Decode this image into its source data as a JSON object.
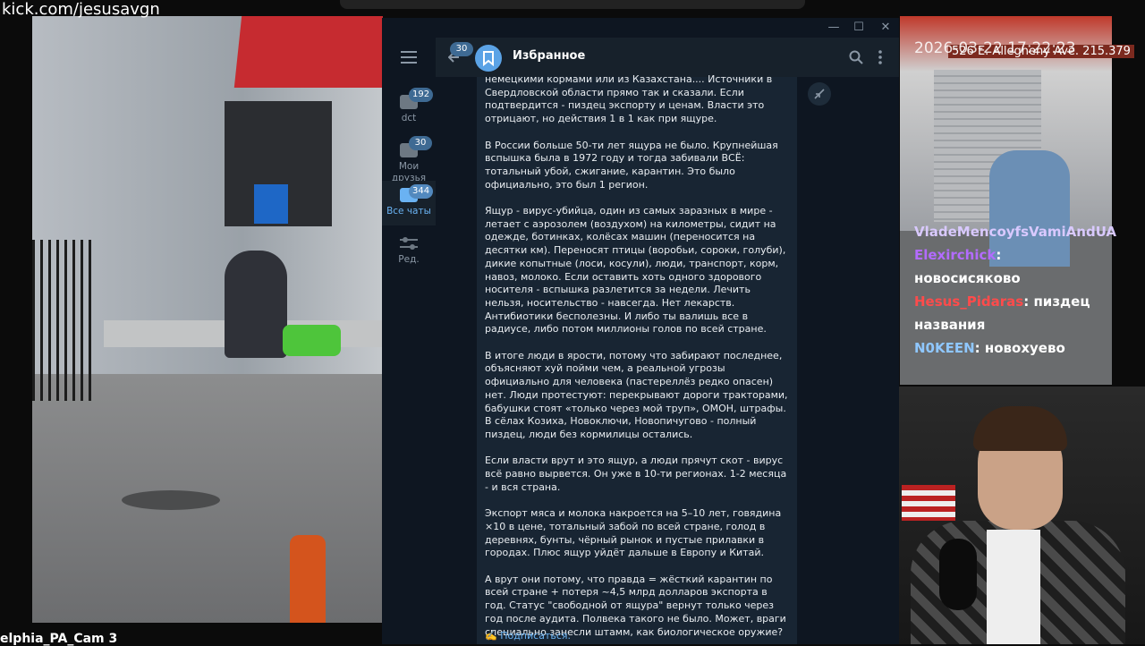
{
  "stream": {
    "url": "kick.com/jesusavgn",
    "cam_label": "elphia_PA_Cam 3",
    "cam_timestamp": "2026-03-22 17:22:23",
    "cam_address": "526 E. Allegheny Ave. 215.379"
  },
  "chat": [
    {
      "user": "VladeMencoyfsVamiAndUA",
      "message": "",
      "color": "#d9c9ff"
    },
    {
      "user": "Elexirchick",
      "message": ": новосисяково",
      "color": "#b36bff"
    },
    {
      "user": "Hesus_Pidaras",
      "message": ": пиздец названия",
      "color": "#ff4b4b"
    },
    {
      "user": "N0KEEN",
      "message": ": новохуево",
      "color": "#8fc7ff"
    }
  ],
  "telegram": {
    "window_buttons": {
      "min": "—",
      "max": "☐",
      "close": "✕"
    },
    "folders": [
      {
        "label": "dct",
        "badge": "192"
      },
      {
        "label": "Мои друзья",
        "badge": "30"
      },
      {
        "label": "Все чаты",
        "badge": "344",
        "active": true
      },
      {
        "label": "Ред.",
        "badge": ""
      }
    ],
    "back_badge": "30",
    "chat_title": "Избранное",
    "message": "немецкими кормами или из Казахстана.... Источники в Свердловской области прямо так и сказали. Если подтвердится - пиздец экспорту и ценам. Власти это отрицают, но действия 1 в 1 как при ящуре.\n\nВ России больше 50-ти лет ящура не было. Крупнейшая вспышка была в 1972 году и тогда забивали ВСЁ:  тотальный убой, сжигание, карантин. Это было официально, это был 1 регион.\n\nЯщур - вирус-убийца, один из самых заразных в мире - летает с аэрозолем (воздухом) на километры, сидит на одежде, ботинках, колёсах машин (переносится на десятки км). Переносят птицы (воробьи, сороки, голуби), дикие копытные (лоси, косули), люди, транспорт, корм, навоз, молоко. Если оставить хоть одного здорового носителя - вспышка разлетится за недели. Лечить нельзя, носительство - навсегда. Нет лекарств. Антибиотики бесполезны. И либо ты валишь все в радиусе, либо потом миллионы голов по всей стране.\n\nВ итоге люди в ярости, потому что забирают последнее, объясняют хуй пойми чем, а реальной угрозы официально для человека (пастереллёз редко опасен) нет. Люди протестуют: перекрывают дороги тракторами, бабушки стоят «только через мой труп», ОМОН, штрафы. В сёлах Козиха, Новоключи, Новопичугово - полный пиздец, люди без кормилицы остались.\n\nЕсли власти врут и это ящур, а люди прячут скот - вирус всё равно вырвется. Он уже в 10-ти регионах. 1-2 месяца - и вся страна.\n\nЭкспорт мяса и молока накроется на 5–10 лет, говядина ×10 в цене, тотальный забой по всей стране, голод в деревнях, бунты, чёрный рынок и пустые прилавки в городах. Плюс ящур уйдёт дальше в Европу и Китай.\n\nА врут они потому, что правда = жёсткий карантин по всей стране + потеря ~4,5 млрд долларов экспорта в год. Статус \"свободной от ящура\" вернут только через год после аудита. Полвека такого не было. Может, враги специально занесли штамм, как биологическое оружие?",
    "subscribe_link": "✍️ Подписаться."
  }
}
